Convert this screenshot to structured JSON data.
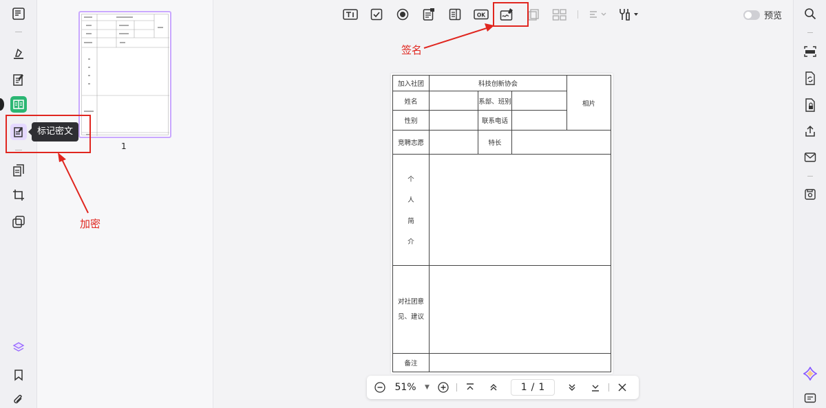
{
  "thumbnail": {
    "page_number": "1"
  },
  "tooltip": {
    "text": "标记密文"
  },
  "annotations": {
    "encrypt_label": "加密",
    "sign_label": "签名"
  },
  "toolbar": {
    "preview_label": "预览"
  },
  "form": {
    "join_club_label": "加入社团",
    "club_name": "科技创新协会",
    "photo_label": "相片",
    "name_label": "姓名",
    "dept_class_label": "系部、班别",
    "gender_label": "性别",
    "phone_label": "联系电话",
    "application_label": "竞聘志愿",
    "specialty_label": "特长",
    "intro_chars": [
      "个",
      "人",
      "简",
      "介"
    ],
    "opinion_label_line1": "对社团意",
    "opinion_label_line2": "见、建议",
    "remarks_label": "备注"
  },
  "bottom_nav": {
    "zoom": "51%",
    "page_current": "1",
    "page_separator": "/",
    "page_total": "1"
  },
  "colors": {
    "annotation_red": "#e0261f",
    "active_green": "#2bb673",
    "active_purple": "#e5d9ff",
    "thumb_border": "#c9a7ff"
  }
}
